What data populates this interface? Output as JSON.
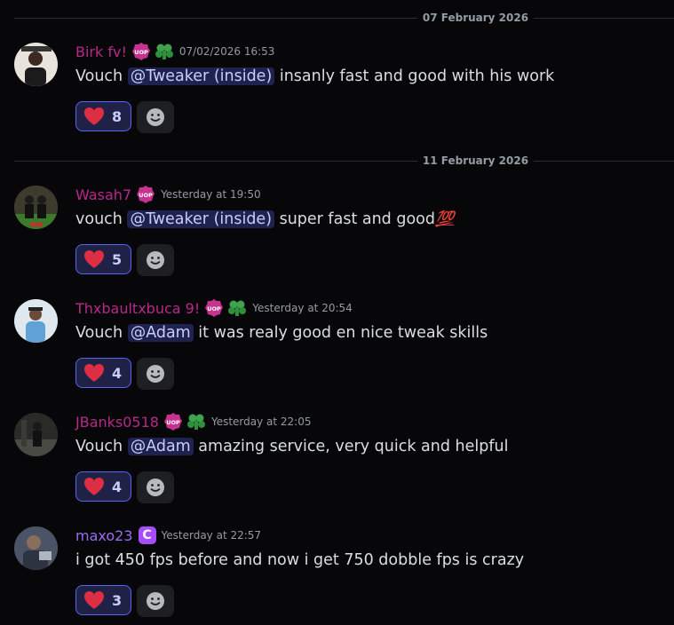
{
  "dividers": [
    {
      "label": "07 February 2026"
    },
    {
      "label": "11 February 2026"
    }
  ],
  "messages": [
    {
      "username": "Birk fv!",
      "badges": [
        "uop-badge",
        "green-leaf-badge"
      ],
      "timestamp": "07/02/2026 16:53",
      "text_before": "Vouch ",
      "mention": "@Tweaker (inside)",
      "text_after": " insanly fast and good with his work",
      "reaction_count": "8"
    },
    {
      "username": "Wasah7",
      "badges": [
        "uop-badge"
      ],
      "timestamp": "Yesterday at 19:50",
      "text_before": "vouch ",
      "mention": "@Tweaker (inside)",
      "text_after": " super fast and good",
      "emoji": "💯",
      "reaction_count": "5"
    },
    {
      "username": "Thxbaultxbuca 9!",
      "badges": [
        "uop-badge",
        "green-leaf-badge"
      ],
      "timestamp": "Yesterday at 20:54",
      "text_before": "Vouch ",
      "mention": "@Adam",
      "text_after": " it was realy good en nice tweak skills",
      "reaction_count": "4"
    },
    {
      "username": "JBanks0518",
      "badges": [
        "uop-badge",
        "green-leaf-badge"
      ],
      "timestamp": "Yesterday at 22:05",
      "text_before": "Vouch ",
      "mention": "@Adam",
      "text_after": " amazing service, very quick and helpful",
      "reaction_count": "4"
    },
    {
      "username": "maxo23",
      "badges": [
        "c-badge"
      ],
      "badge_c_label": "C",
      "timestamp": "Yesterday at 22:57",
      "text_full": "i got 450 fps before and now i get 750 dobble fps is crazy",
      "reaction_count": "3"
    }
  ],
  "colors": {
    "background": "#070709",
    "username_pink": "#b8298a",
    "username_purple": "#9b6cf3",
    "mention_bg": "#353a73",
    "reaction_border": "#5865f2"
  }
}
